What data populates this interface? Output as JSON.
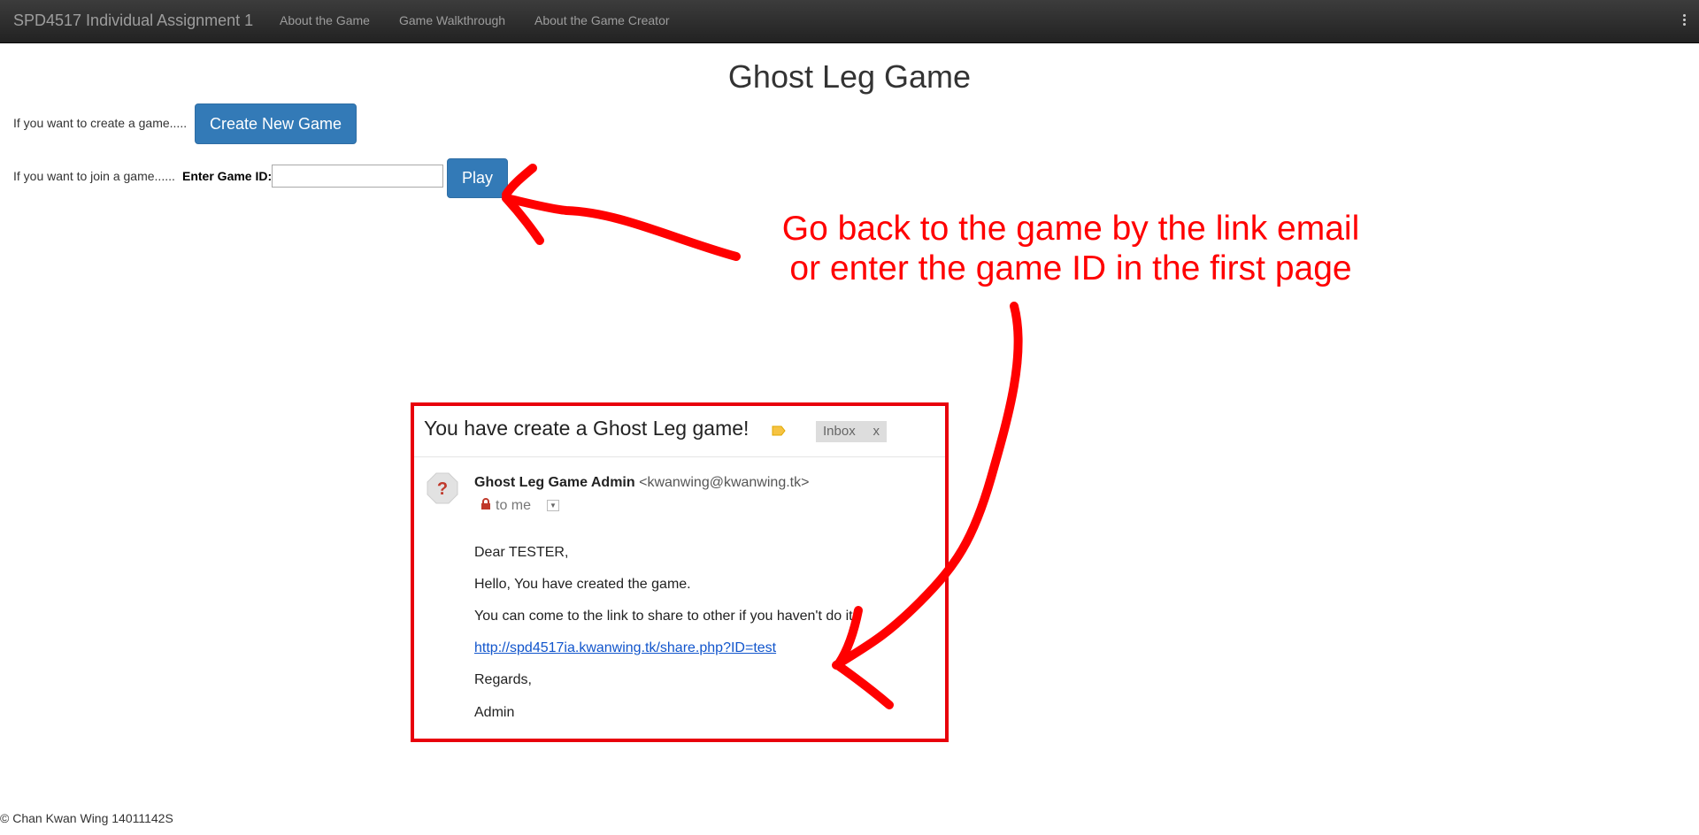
{
  "navbar": {
    "brand": "SPD4517 Individual Assignment 1",
    "links": [
      "About the Game",
      "Game Walkthrough",
      "About the Game Creator"
    ],
    "menu_icon": "kebab-menu-icon"
  },
  "main": {
    "title": "Ghost Leg Game",
    "create_prompt": "If you want to create a game.....",
    "create_button": "Create New Game",
    "join_prompt": "If you want to join a game......",
    "game_id_label": "Enter Game ID:",
    "game_id_value": "",
    "play_button": "Play"
  },
  "annotation": {
    "line1": "Go back to the game by the link email",
    "line2": "or enter the game ID in the first page",
    "color": "#ff0000"
  },
  "email": {
    "subject": "You have create a Ghost Leg game!",
    "inbox_chip": "Inbox",
    "inbox_chip_close": "x",
    "sender_name": "Ghost Leg Game Admin",
    "sender_email": "<kwanwing@kwanwing.tk>",
    "recipient": "to me",
    "greeting": "Dear TESTER,",
    "line1": "Hello, You have created the game.",
    "line2": "You can come to the link to share to other if you haven't do it.",
    "link": "http://spd4517ia.kwanwing.tk/share.php?ID=test",
    "closing": "Regards,",
    "signature": "Admin",
    "border_color": "#e8000b"
  },
  "footer": {
    "text": "© Chan Kwan Wing 14011142S"
  },
  "colors": {
    "navbar_bg": "#222222",
    "primary": "#337ab7",
    "link": "#1155cc"
  }
}
